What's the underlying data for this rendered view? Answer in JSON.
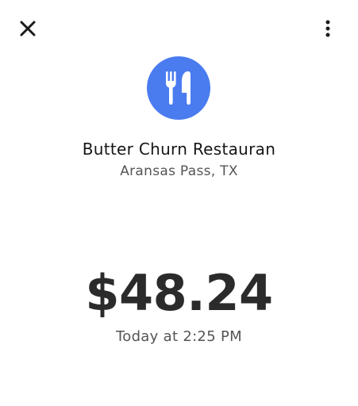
{
  "header": {
    "close_icon": "close-icon",
    "more_icon": "more-vertical-icon"
  },
  "merchant": {
    "icon": "fork-knife-icon",
    "icon_color": "#4A7CF0",
    "name": "Butter Churn Restauran",
    "location": "Aransas Pass, TX"
  },
  "transaction": {
    "amount": "$48.24",
    "time": "Today at 2:25 PM"
  }
}
